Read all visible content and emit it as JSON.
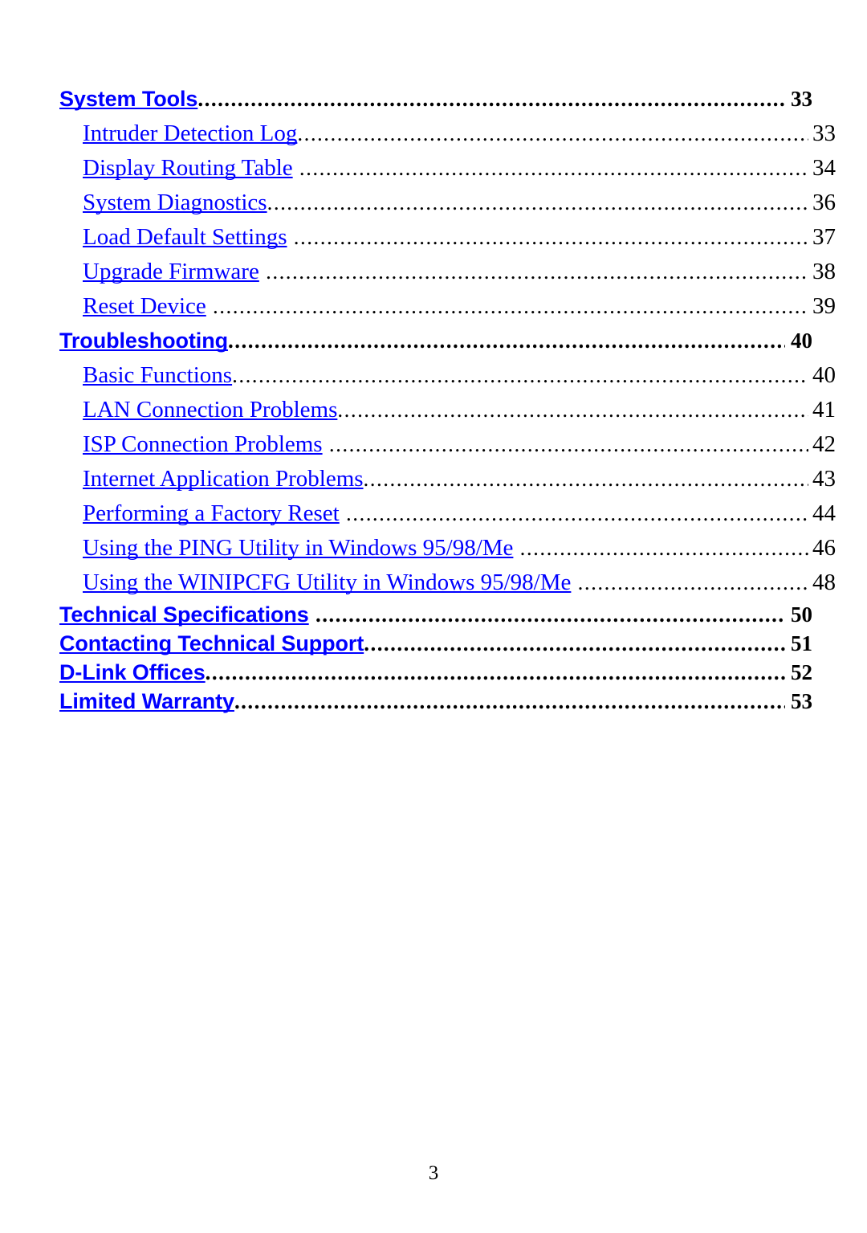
{
  "document": {
    "type": "table-of-contents",
    "folio": "3",
    "colors": {
      "link": "#0000FF",
      "text": "#000000",
      "background": "#FFFFFF"
    }
  },
  "toc": {
    "entries": [
      {
        "level": 1,
        "title": "System Tools",
        "page": "33",
        "space_before_leader": false
      },
      {
        "level": 2,
        "title": "Intruder Detection Log",
        "page": "33",
        "space_before_leader": false
      },
      {
        "level": 2,
        "title": "Display Routing Table",
        "page": "34",
        "space_before_leader": true
      },
      {
        "level": 2,
        "title": "System Diagnostics",
        "page": "36",
        "space_before_leader": false
      },
      {
        "level": 2,
        "title": "Load Default Settings",
        "page": "37",
        "space_before_leader": true
      },
      {
        "level": 2,
        "title": "Upgrade Firmware",
        "page": "38",
        "space_before_leader": true
      },
      {
        "level": 2,
        "title": "Reset Device",
        "page": "39",
        "space_before_leader": true
      },
      {
        "level": 1,
        "title": "Troubleshooting",
        "page": "40",
        "space_before_leader": false
      },
      {
        "level": 2,
        "title": "Basic Functions",
        "page": "40",
        "space_before_leader": false
      },
      {
        "level": 2,
        "title": "LAN Connection Problems",
        "page": "41",
        "space_before_leader": false
      },
      {
        "level": 2,
        "title": "ISP Connection Problems",
        "page": "42",
        "space_before_leader": true
      },
      {
        "level": 2,
        "title": "Internet Application Problems",
        "page": "43",
        "space_before_leader": false
      },
      {
        "level": 2,
        "title": "Performing a Factory Reset",
        "page": "44",
        "space_before_leader": true
      },
      {
        "level": 2,
        "title": "Using the PING Utility in Windows 95/98/Me",
        "page": "46",
        "space_before_leader": true
      },
      {
        "level": 2,
        "title": "Using the WINIPCFG Utility in Windows 95/98/Me",
        "page": "48",
        "space_before_leader": true
      },
      {
        "level": 1,
        "title": "Technical Specifications",
        "page": "50",
        "space_before_leader": true,
        "tight": true
      },
      {
        "level": 1,
        "title": "Contacting Technical Support",
        "page": "51",
        "space_before_leader": false,
        "tight": true
      },
      {
        "level": 1,
        "title": "D-Link Offices",
        "page": "52",
        "space_before_leader": false,
        "tight": true
      },
      {
        "level": 1,
        "title": "Limited Warranty",
        "page": "53",
        "space_before_leader": false,
        "tight": true
      }
    ]
  }
}
